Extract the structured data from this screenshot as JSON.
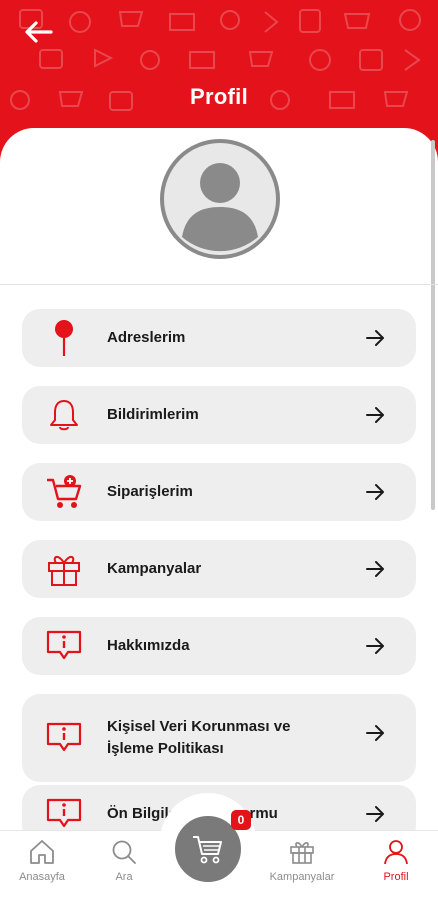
{
  "header": {
    "title": "Profil",
    "back_icon": "arrow-left-icon",
    "background_color": "#e3121b"
  },
  "avatar": {
    "icon": "user-avatar-icon"
  },
  "menu": {
    "items": [
      {
        "label": "Adreslerim",
        "icon": "map-pin-icon"
      },
      {
        "label": "Bildirimlerim",
        "icon": "bell-icon"
      },
      {
        "label": "Siparişlerim",
        "icon": "cart-plus-icon"
      },
      {
        "label": "Kampanyalar",
        "icon": "gift-icon"
      },
      {
        "label": "Hakkımızda",
        "icon": "info-bubble-icon"
      },
      {
        "label": "Kişisel Veri Korunması ve İşleme Politikası",
        "icon": "info-bubble-icon"
      },
      {
        "label": "Ön Bilgilendirme Formu",
        "icon": "info-bubble-icon"
      }
    ],
    "arrow_icon": "arrow-right-icon"
  },
  "bottom_nav": {
    "items": [
      {
        "label": "Anasayfa",
        "icon": "home-icon"
      },
      {
        "label": "Ara",
        "icon": "search-icon"
      },
      {
        "label": "Kampanyalar",
        "icon": "gift-icon"
      },
      {
        "label": "Profil",
        "icon": "user-icon",
        "active": true
      }
    ],
    "cart": {
      "icon": "cart-icon",
      "badge_count": "0"
    }
  },
  "colors": {
    "accent": "#e3121b",
    "card": "#eeeeee",
    "inactive_nav": "#8c8c8c"
  }
}
